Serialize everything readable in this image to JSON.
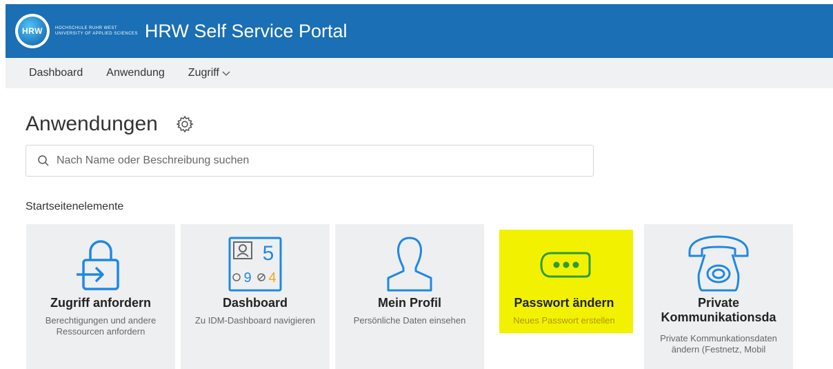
{
  "header": {
    "logo_abbr": "HRW",
    "logo_line1": "HOCHSCHULE RUHR WEST",
    "logo_line2": "UNIVERSITY OF APPLIED SCIENCES",
    "title": "HRW Self Service Portal"
  },
  "nav": {
    "items": [
      {
        "label": "Dashboard"
      },
      {
        "label": "Anwendung"
      },
      {
        "label": "Zugriff"
      }
    ]
  },
  "main": {
    "title": "Anwendungen",
    "search_placeholder": "Nach Name oder Beschreibung suchen",
    "section_label": "Startseitenelemente"
  },
  "tiles": [
    {
      "title": "Zugriff anfordern",
      "desc": "Berechtigungen und andere Ressourcen anfordern",
      "icon": "lock-arrow-icon"
    },
    {
      "title": "Dashboard",
      "desc": "Zu IDM-Dashboard navigieren",
      "icon": "dashboard-icon",
      "badge_main": "5",
      "badge_clock": "9",
      "badge_slash": "4"
    },
    {
      "title": "Mein Profil",
      "desc": "Persönliche Daten einsehen",
      "icon": "person-icon"
    },
    {
      "title": "Passwort ändern",
      "desc": "Neues Passwort erstellen",
      "icon": "password-icon"
    },
    {
      "title": "Private Kommunikationsda",
      "desc": "Private Kommunkationsdaten ändern (Festnetz, Mobil",
      "icon": "telephone-icon"
    }
  ],
  "colors": {
    "header_bg": "#1a6fb5",
    "icon_blue": "#1e88e5",
    "icon_green": "#2e9b3a",
    "badge_orange": "#f5a623",
    "highlight": "#f2f200"
  }
}
